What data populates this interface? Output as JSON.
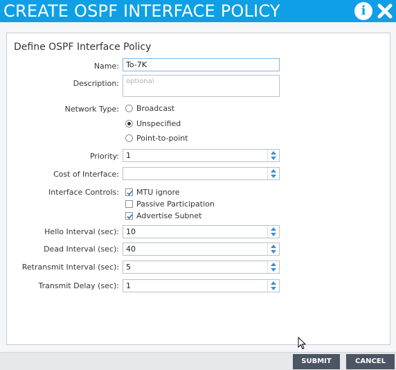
{
  "dialog": {
    "title": "CREATE OSPF INTERFACE POLICY",
    "info_icon": "info-icon",
    "close_icon": "close-icon"
  },
  "form": {
    "heading": "Define OSPF Interface Policy",
    "name": {
      "label": "Name:",
      "value": "To-7K"
    },
    "description": {
      "label": "Description:",
      "placeholder": "optional",
      "value": ""
    },
    "network_type": {
      "label": "Network Type:",
      "options": [
        "Broadcast",
        "Unspecified",
        "Point-to-point"
      ],
      "selected": "Unspecified"
    },
    "priority": {
      "label": "Priority:",
      "value": "1"
    },
    "cost": {
      "label": "Cost of Interface:",
      "value": ""
    },
    "interface_controls": {
      "label": "Interface Controls:",
      "options": [
        {
          "label": "MTU ignore",
          "checked": true
        },
        {
          "label": "Passive Participation",
          "checked": false
        },
        {
          "label": "Advertise Subnet",
          "checked": true
        }
      ]
    },
    "hello_interval": {
      "label": "Hello Interval (sec):",
      "value": "10"
    },
    "dead_interval": {
      "label": "Dead Interval (sec):",
      "value": "40"
    },
    "retransmit_interval": {
      "label": "Retransmit Interval (sec):",
      "value": "5"
    },
    "transmit_delay": {
      "label": "Transmit Delay (sec):",
      "value": "1"
    }
  },
  "footer": {
    "submit": "SUBMIT",
    "cancel": "CANCEL"
  },
  "colors": {
    "header": "#0f9fe6",
    "button": "#4b5563",
    "panel_border": "#c6cbd2"
  }
}
